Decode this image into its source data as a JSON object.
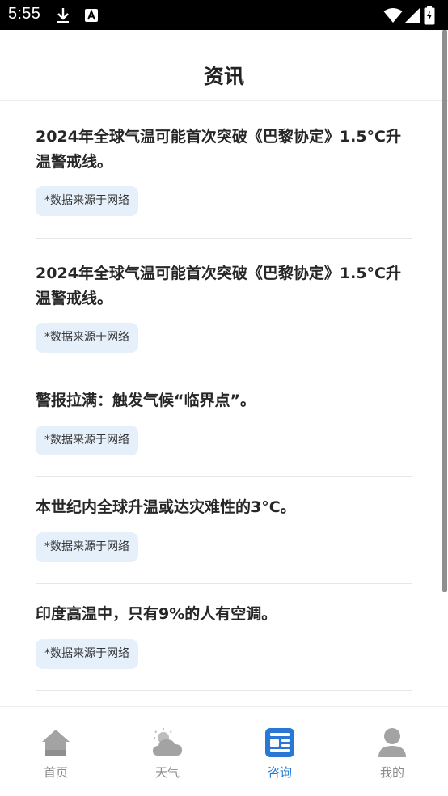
{
  "status_bar": {
    "time": "5:55",
    "icons": [
      "download-icon",
      "a-box-icon",
      "wifi-icon",
      "signal-icon",
      "battery-icon"
    ]
  },
  "header": {
    "title": "资讯"
  },
  "news": [
    {
      "title": "2024年全球气温可能首次突破《巴黎协定》1.5°C升温警戒线。",
      "tag": "*数据来源于网络"
    },
    {
      "title": "2024年全球气温可能首次突破《巴黎协定》1.5°C升温警戒线。",
      "tag": "*数据来源于网络"
    },
    {
      "title": "警报拉满：触发气候“临界点”。",
      "tag": "*数据来源于网络"
    },
    {
      "title": "本世纪内全球升温或达灾难性的3°C。",
      "tag": "*数据来源于网络"
    },
    {
      "title": "印度高温中，只有9%的人有空调。",
      "tag": "*数据来源于网络"
    }
  ],
  "bottom_nav": {
    "items": [
      {
        "label": "首页",
        "icon": "home-icon"
      },
      {
        "label": "天气",
        "icon": "weather-icon"
      },
      {
        "label": "咨询",
        "icon": "news-icon"
      },
      {
        "label": "我的",
        "icon": "user-icon"
      }
    ],
    "active_index": 2
  },
  "colors": {
    "accent": "#2a78d6",
    "tag_background": "#e6f0fb",
    "inactive_icon": "#a3a3a3",
    "status_bar": "#000000"
  }
}
